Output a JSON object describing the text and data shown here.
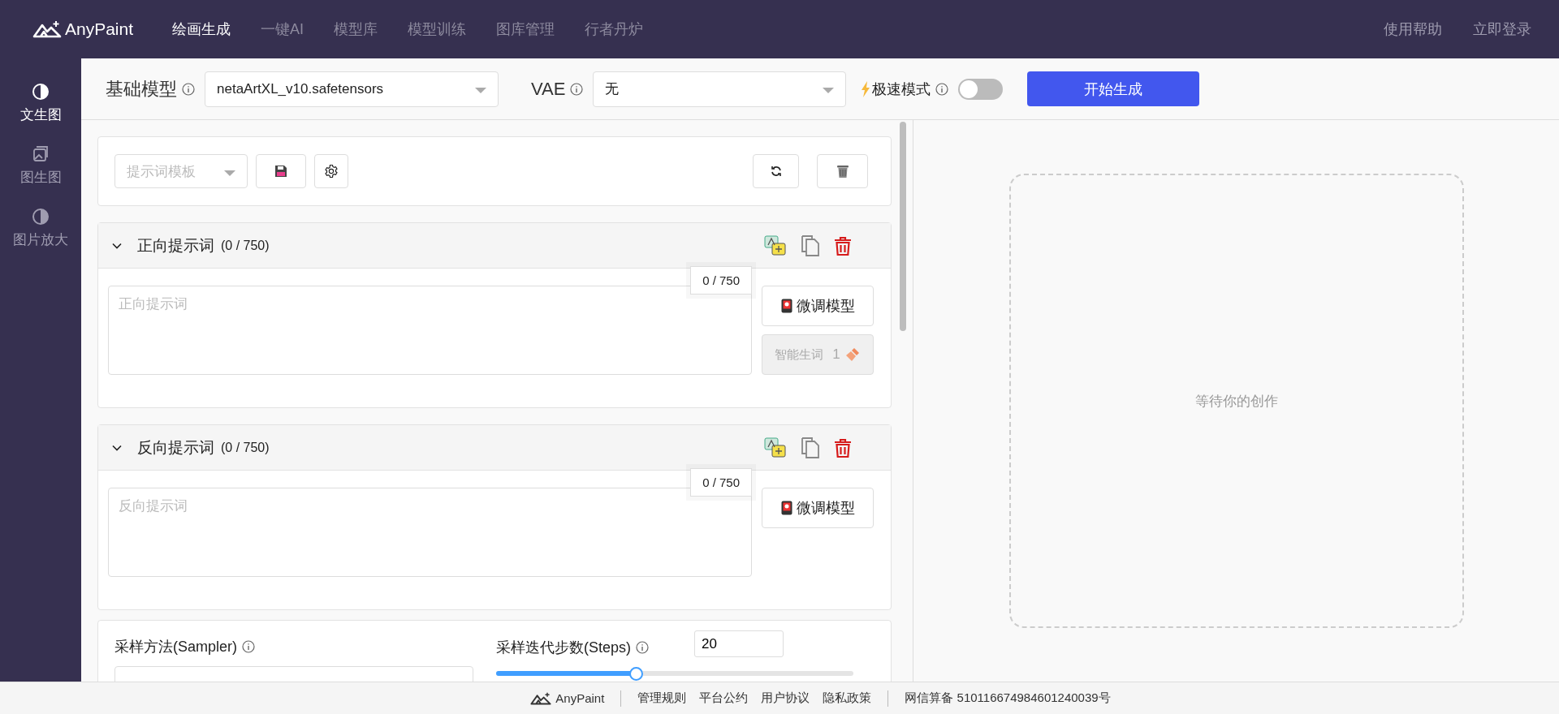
{
  "header": {
    "logo": "AnyPaint",
    "nav": [
      {
        "label": "绘画生成",
        "selected": true
      },
      {
        "label": "一键AI",
        "selected": false
      },
      {
        "label": "模型库",
        "selected": false
      },
      {
        "label": "模型训练",
        "selected": false
      },
      {
        "label": "图库管理",
        "selected": false
      },
      {
        "label": "行者丹炉",
        "selected": false
      }
    ],
    "links": [
      "使用帮助",
      "立即登录"
    ]
  },
  "sidebar": {
    "items": [
      {
        "label": "文生图",
        "selected": true
      },
      {
        "label": "图生图",
        "selected": false
      },
      {
        "label": "图片放大",
        "selected": false
      }
    ]
  },
  "toolbar": {
    "model_label": "基础模型",
    "model_value": "netaArtXL_v10.safetensors",
    "vae_label": "VAE",
    "vae_value": "无",
    "turbo_label": "极速模式",
    "turbo_on": false,
    "generate": "开始生成"
  },
  "template": {
    "placeholder": "提示词模板"
  },
  "prompts": [
    {
      "title": "正向提示词",
      "count": "(0 / 750)",
      "counter": "0 / 750",
      "placeholder": "正向提示词",
      "expanded": true,
      "buttons": [
        {
          "kind": "lora",
          "label": "微调模型",
          "disabled": false
        },
        {
          "kind": "smart",
          "label": "智能生词",
          "badge": "1",
          "disabled": true
        }
      ]
    },
    {
      "title": "反向提示词",
      "count": "(0 / 750)",
      "counter": "0 / 750",
      "placeholder": "反向提示词",
      "expanded": true,
      "buttons": [
        {
          "kind": "lora",
          "label": "微调模型",
          "disabled": false
        }
      ]
    }
  ],
  "sampler": {
    "label": "采样方法(Sampler)"
  },
  "steps": {
    "label": "采样迭代步数(Steps)",
    "value": "20",
    "level": 0.39
  },
  "preview": {
    "text": "等待你的创作"
  },
  "footer": {
    "logo": "AnyPaint",
    "links": [
      "管理规则",
      "平台公约",
      "用户协议",
      "隐私政策"
    ],
    "icp": "网信算备 510116674984601240039号"
  }
}
